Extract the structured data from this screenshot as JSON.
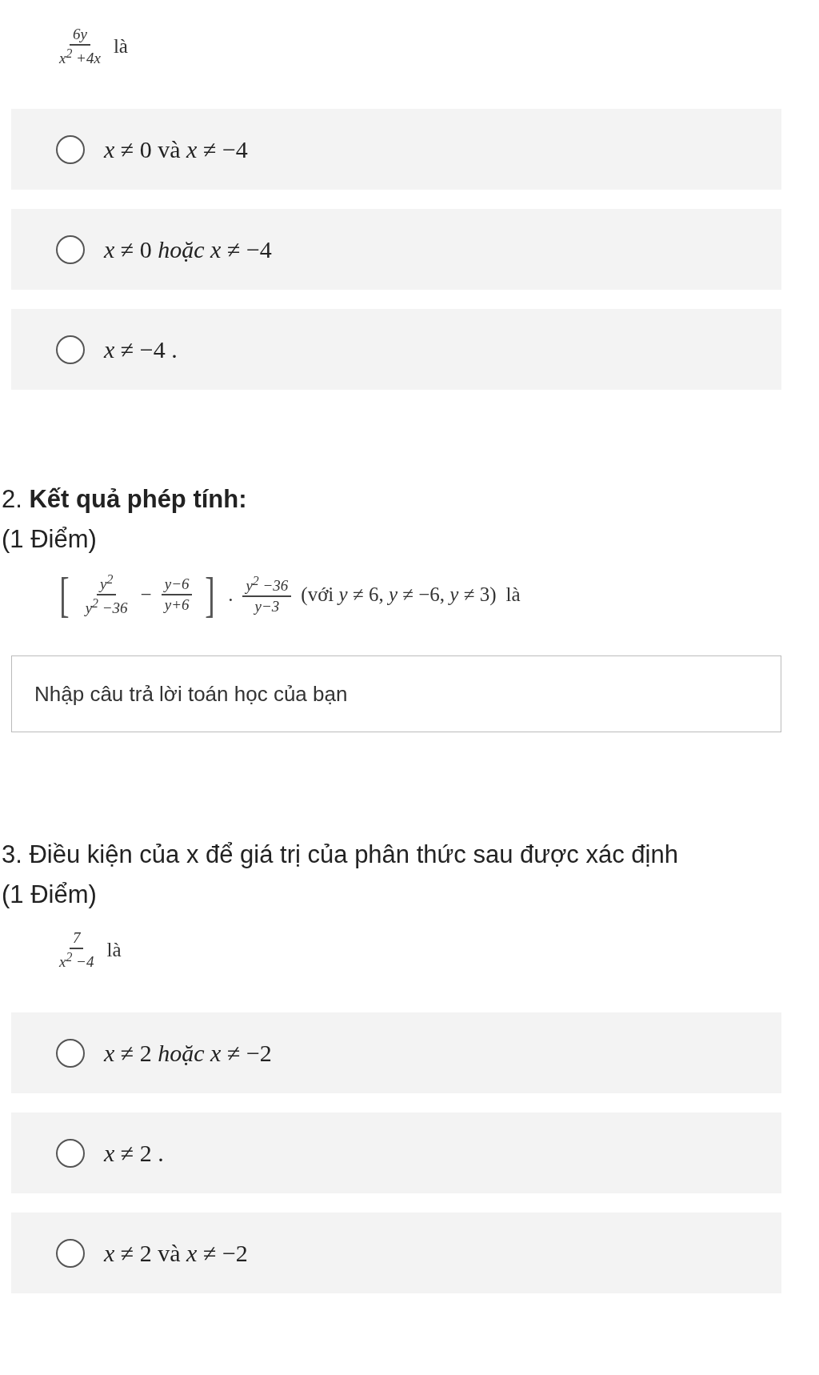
{
  "blocks": [
    {
      "kind": "formula",
      "parts": [
        {
          "kind": "frac",
          "num": "6y",
          "den": "x$^{2}$ +4x"
        },
        {
          "kind": "text",
          "text": "là"
        }
      ]
    },
    {
      "kind": "option",
      "text": "*x* ≠ 0 và *x* ≠ −4",
      "selected": false
    },
    {
      "kind": "option",
      "text": "*x* ≠ 0 *hoặc x* ≠ −4",
      "selected": false
    },
    {
      "kind": "option",
      "text": "*x* ≠ −4 .",
      "selected": false
    },
    {
      "kind": "question",
      "text": "2. **Kết quả phép tính:**"
    },
    {
      "kind": "points",
      "text": "(1 Điểm)"
    },
    {
      "kind": "formula",
      "parts": [
        {
          "kind": "bracket",
          "text": "["
        },
        {
          "kind": "frac",
          "num": "*y*$^{2}$",
          "den": "*y*$^{2}$ −36"
        },
        {
          "kind": "text",
          "text": "−"
        },
        {
          "kind": "frac",
          "num": "*y*−6",
          "den": "*y*+6"
        },
        {
          "kind": "bracket",
          "text": "]"
        },
        {
          "kind": "text",
          "text": "."
        },
        {
          "kind": "frac",
          "num": "*y*$^{2}$ −36",
          "den": "*y*−3"
        },
        {
          "kind": "text",
          "text": "(với *y* ≠ 6,  *y* ≠ −6,  *y* ≠ 3)"
        },
        {
          "kind": "text",
          "text": "là"
        }
      ]
    },
    {
      "kind": "answer",
      "placeholder": "Nhập câu trả lời toán học của bạn"
    },
    {
      "kind": "question",
      "text": "3. Điều kiện của x để giá trị của phân thức sau được xác định"
    },
    {
      "kind": "points",
      "text": "(1 Điểm)"
    },
    {
      "kind": "formula",
      "parts": [
        {
          "kind": "frac",
          "num": "7",
          "den": "x$^{2}$ −4"
        },
        {
          "kind": "text",
          "text": "là"
        }
      ]
    },
    {
      "kind": "option",
      "text": "*x* ≠ 2 *hoặc x* ≠ −2",
      "selected": false
    },
    {
      "kind": "option",
      "text": "*x* ≠ 2 .",
      "selected": false
    },
    {
      "kind": "option",
      "text": "*x* ≠ 2 và *x* ≠ −2",
      "selected": false
    }
  ]
}
